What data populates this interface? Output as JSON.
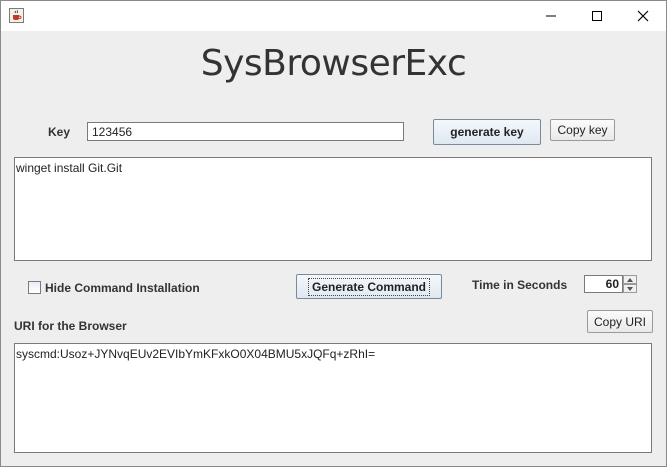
{
  "window": {
    "app_icon": "java-cup-icon",
    "controls": [
      "minimize-icon",
      "maximize-icon",
      "close-icon"
    ]
  },
  "heading": "SysBrowserExc",
  "key": {
    "label": "Key",
    "value": "123456",
    "generate_button": "generate key",
    "copy_button": "Copy key"
  },
  "command": {
    "text": "winget install Git.Git"
  },
  "options": {
    "hide_checkbox_label": "Hide Command Installation",
    "hide_checked": false,
    "generate_button": "Generate Command",
    "time_label": "Time in Seconds",
    "time_value": "60"
  },
  "uri": {
    "label": "URI for the Browser",
    "copy_button": "Copy URI",
    "value": "syscmd:Usoz+JYNvqEUv2EVIbYmKFxkO0X04BMU5xJQFq+zRhI="
  },
  "colors": {
    "background": "#eeeeee",
    "button_gradient_top": "#f4f8fc",
    "button_gradient_bottom": "#dfe8f1"
  }
}
